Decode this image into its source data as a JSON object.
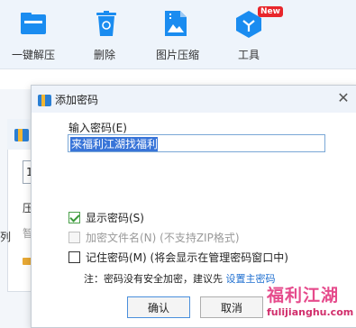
{
  "toolbar": {
    "items": [
      {
        "label": "一键解压",
        "icon": "folder-extract-icon"
      },
      {
        "label": "删除",
        "icon": "recycle-bin-icon"
      },
      {
        "label": "图片压缩",
        "icon": "image-compress-icon"
      },
      {
        "label": "工具",
        "icon": "tools-cube-icon",
        "badge": "New"
      }
    ]
  },
  "background_window": {
    "input_value": "1",
    "texts": [
      "压",
      "智",
      "列"
    ]
  },
  "dialog": {
    "title": "添加密码",
    "password_label": "输入密码(E)",
    "password_value": "来福利江湖找福利",
    "show_password": {
      "label": "显示密码(S)",
      "checked": true
    },
    "encrypt_filenames": {
      "label": "加密文件名(N) (不支持ZIP格式)",
      "checked": false,
      "disabled": true
    },
    "remember_password": {
      "label": "记住密码(M) (将会显示在管理密码窗口中)",
      "checked": false
    },
    "note_prefix": "注：密码没有安全加密，建议先 ",
    "note_link": "设置主密码",
    "ok_label": "确认",
    "cancel_label": "取消"
  },
  "watermark": {
    "cn": "福利江湖",
    "url": "fulijianghu.com"
  },
  "colors": {
    "accent": "#1e6fd0",
    "selection": "#3874d8",
    "badge": "#e8262b",
    "checkmark": "#3a9a3a"
  }
}
